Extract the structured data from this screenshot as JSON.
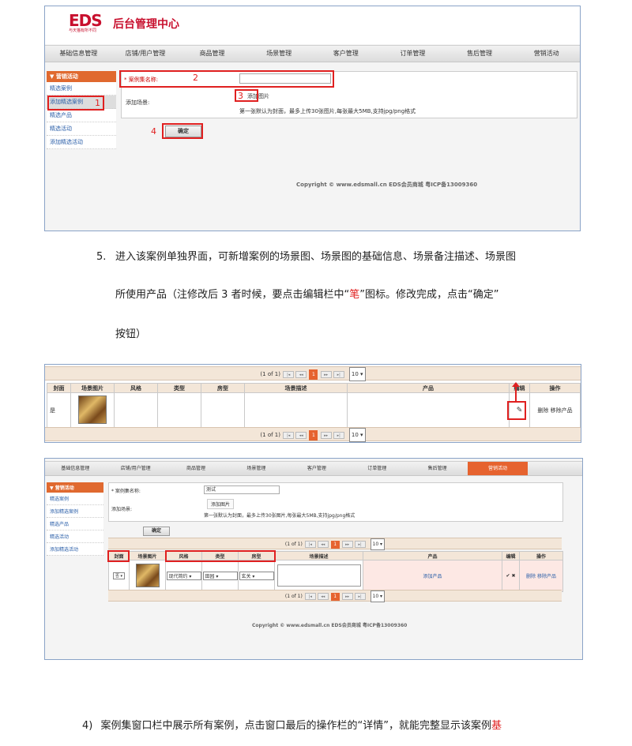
{
  "shot1": {
    "logo": "EDS",
    "logo_sub": "与天猫有所不同",
    "title": "后台管理中心",
    "nav": [
      "基础信息管理",
      "店铺/用户管理",
      "商品管理",
      "场景管理",
      "客户管理",
      "订单管理",
      "售后管理",
      "营销活动"
    ],
    "side_head": "▼ 营销活动",
    "side": [
      "精选案例",
      "添加精选案例",
      "精选产品",
      "精选活动",
      "添加精选活动"
    ],
    "name_label": "* 案例集名称:",
    "scene_label": "添加场景:",
    "add_img": "添加图片",
    "hint": "第一张默认为封面，最多上传30张图片,每张最大5MB,支持jpg/png格式",
    "confirm": "确定",
    "copyright": "Copyright © www.edsmall.cn EDS会员商城 粤ICP备13009360",
    "nums": [
      "1",
      "2",
      "3",
      "4"
    ]
  },
  "para5": {
    "index": "5.",
    "line1": "进入该案例单独界面，可新增案例的场景图、场景图的基础信息、场景备注描述、场景图",
    "line2a": "所使用产品（注修改后 3 者时候，要点击编辑栏中“",
    "pen": "笔",
    "line2b": "”图标。修改完成，点击“确定”",
    "line3": "按钮）"
  },
  "shot2": {
    "pager": "(1 of 1)",
    "page": "1",
    "per": "10 ▾",
    "cols": [
      "封面",
      "场景图片",
      "风格",
      "类型",
      "房型",
      "场景描述",
      "产品",
      "编辑",
      "操作"
    ],
    "row": {
      "cover": "是",
      "edit": "✎",
      "ops": "删除 移除产品"
    }
  },
  "shot3": {
    "nav": [
      "基础信息管理",
      "店铺/用户管理",
      "商品管理",
      "场景管理",
      "客户管理",
      "订单管理",
      "售后管理",
      "营销活动"
    ],
    "side_head": "▼ 营销活动",
    "side": [
      "精选案例",
      "添加精选案例",
      "精选产品",
      "精选活动",
      "添加精选活动"
    ],
    "name_label": "* 案例集名称:",
    "name_value": "测试",
    "scene_label": "添加场景:",
    "add_img": "添加图片",
    "hint": "第一张默认为封面，最多上传30张图片,每张最大5MB,支持jpg/png格式",
    "confirm": "确定",
    "pager": "(1 of 1)",
    "page": "1",
    "per": "10 ▾",
    "cols": [
      "封面",
      "场景图片",
      "风格",
      "类型",
      "房型",
      "场景描述",
      "产品",
      "编辑",
      "操作"
    ],
    "row": {
      "cover": "否 ▾",
      "style": "现代简约",
      "type": "田园",
      "room": "玄关",
      "add_product": "添加产品",
      "edit": "✔ ✖",
      "ops": "删除 移除产品"
    },
    "copyright": "Copyright © www.edsmall.cn EDS会员商城 粤ICP备13009360"
  },
  "para4": {
    "index": "4)",
    "text": "案例集窗口栏中展示所有案例，点击窗口最后的操作栏的“详情”，就能完整显示该案例",
    "red": "基"
  }
}
